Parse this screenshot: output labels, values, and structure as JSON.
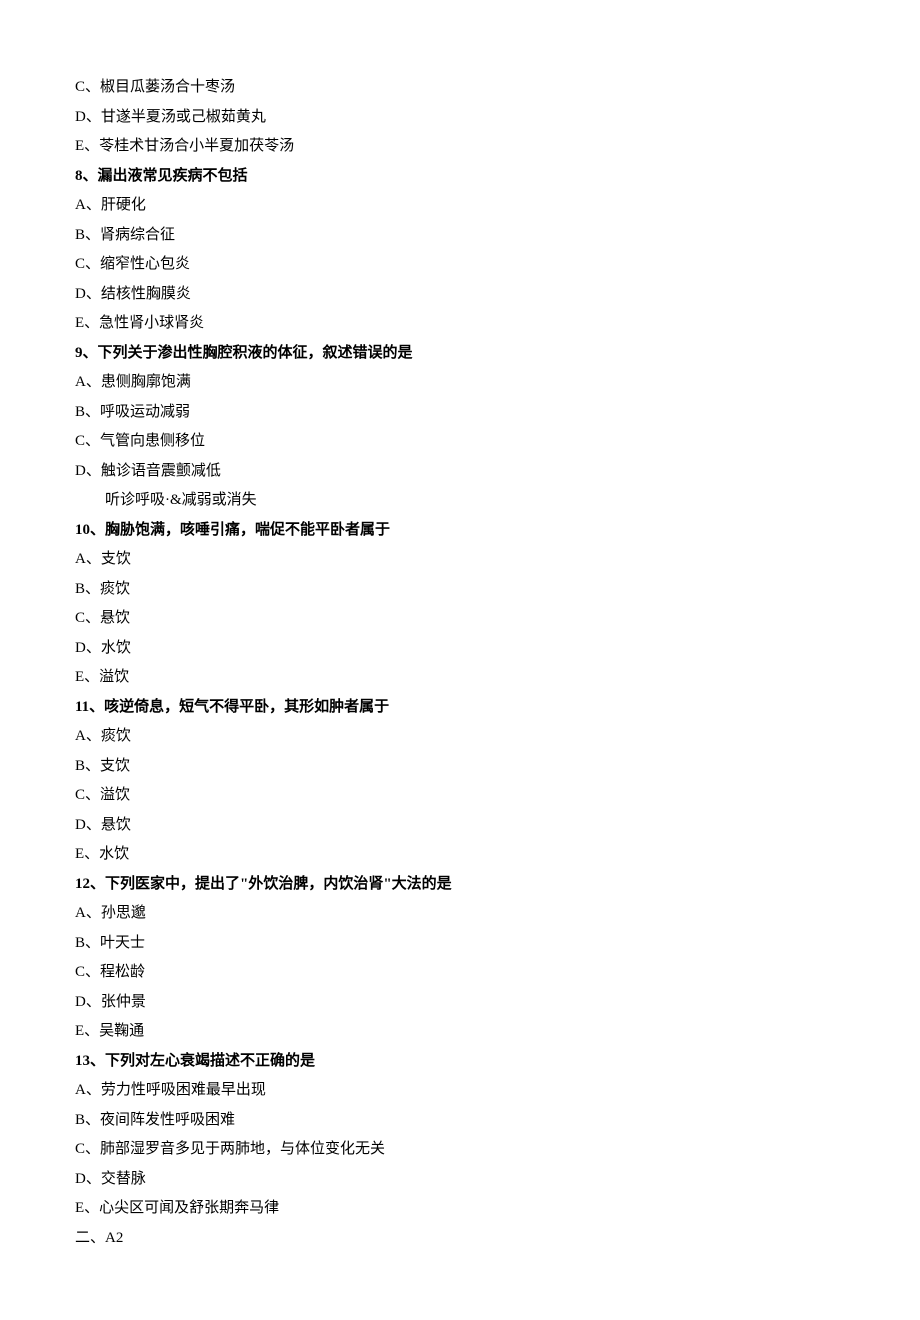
{
  "lines": [
    {
      "text": "C、椒目瓜蒌汤合十枣汤",
      "bold": false,
      "indent": false
    },
    {
      "text": "D、甘遂半夏汤或己椒茹黄丸",
      "bold": false,
      "indent": false
    },
    {
      "text": "E、苓桂术甘汤合小半夏加茯苓汤",
      "bold": false,
      "indent": false
    },
    {
      "text": "8、漏出液常见疾病不包括",
      "bold": true,
      "indent": false
    },
    {
      "text": "A、肝硬化",
      "bold": false,
      "indent": false
    },
    {
      "text": "B、肾病综合征",
      "bold": false,
      "indent": false
    },
    {
      "text": "C、缩窄性心包炎",
      "bold": false,
      "indent": false
    },
    {
      "text": "D、结核性胸膜炎",
      "bold": false,
      "indent": false
    },
    {
      "text": "E、急性肾小球肾炎",
      "bold": false,
      "indent": false
    },
    {
      "text": "9、下列关于渗出性胸腔积液的体征，叙述错误的是",
      "bold": true,
      "indent": false
    },
    {
      "text": "A、患侧胸廓饱满",
      "bold": false,
      "indent": false
    },
    {
      "text": "B、呼吸运动减弱",
      "bold": false,
      "indent": false
    },
    {
      "text": "C、气管向患侧移位",
      "bold": false,
      "indent": false
    },
    {
      "text": "D、触诊语音震颤减低",
      "bold": false,
      "indent": false
    },
    {
      "text": "听诊呼吸·&减弱或消失",
      "bold": false,
      "indent": true
    },
    {
      "text": "10、胸胁饱满，咳唾引痛，喘促不能平卧者属于",
      "bold": true,
      "indent": false
    },
    {
      "text": "A、支饮",
      "bold": false,
      "indent": false
    },
    {
      "text": "B、痰饮",
      "bold": false,
      "indent": false
    },
    {
      "text": "C、悬饮",
      "bold": false,
      "indent": false
    },
    {
      "text": "D、水饮",
      "bold": false,
      "indent": false
    },
    {
      "text": "E、溢饮",
      "bold": false,
      "indent": false
    },
    {
      "text": "11、咳逆倚息，短气不得平卧，其形如肿者属于",
      "bold": true,
      "indent": false
    },
    {
      "text": "A、痰饮",
      "bold": false,
      "indent": false
    },
    {
      "text": "B、支饮",
      "bold": false,
      "indent": false
    },
    {
      "text": "C、溢饮",
      "bold": false,
      "indent": false
    },
    {
      "text": "D、悬饮",
      "bold": false,
      "indent": false
    },
    {
      "text": "E、水饮",
      "bold": false,
      "indent": false
    },
    {
      "text": "12、下列医家中，提出了\"外饮治脾，内饮治肾\"大法的是",
      "bold": true,
      "indent": false
    },
    {
      "text": "A、孙思邈",
      "bold": false,
      "indent": false
    },
    {
      "text": "B、叶天士",
      "bold": false,
      "indent": false
    },
    {
      "text": "C、程松龄",
      "bold": false,
      "indent": false
    },
    {
      "text": "D、张仲景",
      "bold": false,
      "indent": false
    },
    {
      "text": "E、吴鞠通",
      "bold": false,
      "indent": false
    },
    {
      "text": "13、下列对左心衰竭描述不正确的是",
      "bold": true,
      "indent": false
    },
    {
      "text": "A、劳力性呼吸困难最早出现",
      "bold": false,
      "indent": false
    },
    {
      "text": "B、夜间阵发性呼吸困难",
      "bold": false,
      "indent": false
    },
    {
      "text": "C、肺部湿罗音多见于两肺地，与体位变化无关",
      "bold": false,
      "indent": false
    },
    {
      "text": "D、交替脉",
      "bold": false,
      "indent": false
    },
    {
      "text": "E、心尖区可闻及舒张期奔马律",
      "bold": false,
      "indent": false
    },
    {
      "text": "二、A2",
      "bold": false,
      "indent": false
    }
  ]
}
